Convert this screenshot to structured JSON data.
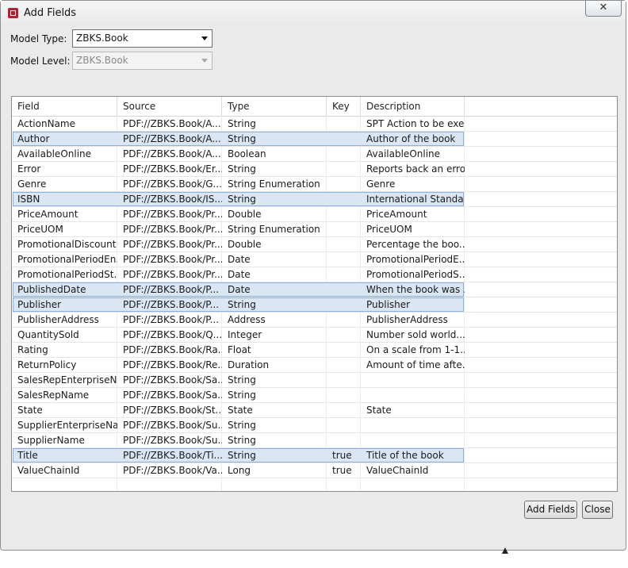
{
  "window": {
    "title": "Add Fields",
    "close_glyph": "✕"
  },
  "form": {
    "model_type_label": "Model Type:",
    "model_type_value": "ZBKS.Book",
    "model_level_label": "Model Level:",
    "model_level_value": "ZBKS.Book"
  },
  "table": {
    "columns": [
      "Field",
      "Source",
      "Type",
      "Key",
      "Description"
    ],
    "rows": [
      {
        "field": "ActionName",
        "source": "PDF://ZBKS.Book/A...",
        "type": "String",
        "key": "",
        "description": "SPT Action to be exe...",
        "selected": false
      },
      {
        "field": "Author",
        "source": "PDF://ZBKS.Book/A...",
        "type": "String",
        "key": "",
        "description": "Author of the book",
        "selected": true
      },
      {
        "field": "AvailableOnline",
        "source": "PDF://ZBKS.Book/A...",
        "type": "Boolean",
        "key": "",
        "description": "AvailableOnline",
        "selected": false
      },
      {
        "field": "Error",
        "source": "PDF://ZBKS.Book/Er...",
        "type": "String",
        "key": "",
        "description": "Reports back an erro...",
        "selected": false
      },
      {
        "field": "Genre",
        "source": "PDF://ZBKS.Book/G...",
        "type": "String Enumeration",
        "key": "",
        "description": "Genre",
        "selected": false
      },
      {
        "field": "ISBN",
        "source": "PDF://ZBKS.Book/IS...",
        "type": "String",
        "key": "",
        "description": "International Standa...",
        "selected": true
      },
      {
        "field": "PriceAmount",
        "source": "PDF://ZBKS.Book/Pr...",
        "type": "Double",
        "key": "",
        "description": "PriceAmount",
        "selected": false
      },
      {
        "field": "PriceUOM",
        "source": "PDF://ZBKS.Book/Pr...",
        "type": "String Enumeration",
        "key": "",
        "description": "PriceUOM",
        "selected": false
      },
      {
        "field": "PromotionalDiscount",
        "source": "PDF://ZBKS.Book/Pr...",
        "type": "Double",
        "key": "",
        "description": "Percentage the boo...",
        "selected": false
      },
      {
        "field": "PromotionalPeriodEn...",
        "source": "PDF://ZBKS.Book/Pr...",
        "type": "Date",
        "key": "",
        "description": "PromotionalPeriodE...",
        "selected": false
      },
      {
        "field": "PromotionalPeriodSt...",
        "source": "PDF://ZBKS.Book/Pr...",
        "type": "Date",
        "key": "",
        "description": "PromotionalPeriodS...",
        "selected": false
      },
      {
        "field": "PublishedDate",
        "source": "PDF://ZBKS.Book/P...",
        "type": "Date",
        "key": "",
        "description": "When the book was ...",
        "selected": true
      },
      {
        "field": "Publisher",
        "source": "PDF://ZBKS.Book/P...",
        "type": "String",
        "key": "",
        "description": "Publisher",
        "selected": true
      },
      {
        "field": "PublisherAddress",
        "source": "PDF://ZBKS.Book/P...",
        "type": "Address",
        "key": "",
        "description": "PublisherAddress",
        "selected": false
      },
      {
        "field": "QuantitySold",
        "source": "PDF://ZBKS.Book/Q...",
        "type": "Integer",
        "key": "",
        "description": "Number sold world...",
        "selected": false
      },
      {
        "field": "Rating",
        "source": "PDF://ZBKS.Book/Ra...",
        "type": "Float",
        "key": "",
        "description": "On a scale from 1-1...",
        "selected": false
      },
      {
        "field": "ReturnPolicy",
        "source": "PDF://ZBKS.Book/Re...",
        "type": "Duration",
        "key": "",
        "description": "Amount of time afte...",
        "selected": false
      },
      {
        "field": "SalesRepEnterpriseNa...",
        "source": "PDF://ZBKS.Book/Sa...",
        "type": "String",
        "key": "",
        "description": "",
        "selected": false
      },
      {
        "field": "SalesRepName",
        "source": "PDF://ZBKS.Book/Sa...",
        "type": "String",
        "key": "",
        "description": "",
        "selected": false
      },
      {
        "field": "State",
        "source": "PDF://ZBKS.Book/St...",
        "type": "State",
        "key": "",
        "description": "State",
        "selected": false
      },
      {
        "field": "SupplierEnterpriseNa...",
        "source": "PDF://ZBKS.Book/Su...",
        "type": "String",
        "key": "",
        "description": "",
        "selected": false
      },
      {
        "field": "SupplierName",
        "source": "PDF://ZBKS.Book/Su...",
        "type": "String",
        "key": "",
        "description": "",
        "selected": false
      },
      {
        "field": "Title",
        "source": "PDF://ZBKS.Book/Ti...",
        "type": "String",
        "key": "true",
        "description": "Title of the book",
        "selected": true
      },
      {
        "field": "ValueChainId",
        "source": "PDF://ZBKS.Book/Va...",
        "type": "Long",
        "key": "true",
        "description": "ValueChainId",
        "selected": false
      }
    ]
  },
  "buttons": {
    "add_fields": "Add Fields",
    "close": "Close"
  }
}
